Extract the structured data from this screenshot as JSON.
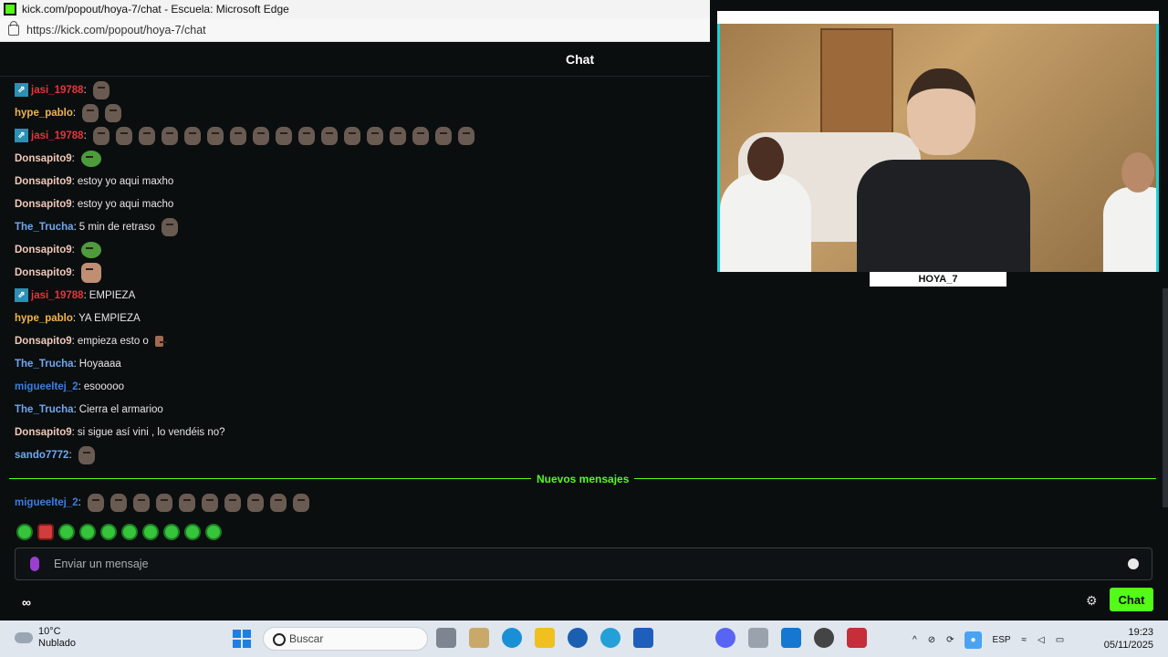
{
  "window": {
    "title": "kick.com/popout/hoya-7/chat - Escuela: Microsoft Edge"
  },
  "address": {
    "url": "https://kick.com/popout/hoya-7/chat"
  },
  "chat_header": {
    "title": "Chat"
  },
  "messages": [
    {
      "user": "jasi_19788",
      "color": "#e8343a",
      "badge": true,
      "text": "",
      "emotes": [
        "face-emote"
      ]
    },
    {
      "user": "hype_pablo",
      "color": "#f0b44a",
      "badge": false,
      "text": "",
      "emotes": [
        "face-emote",
        "face-emote"
      ]
    },
    {
      "user": "jasi_19788",
      "color": "#e8343a",
      "badge": true,
      "text": "",
      "emotes": [
        "face-emote",
        "face-emote",
        "face-emote",
        "face-emote",
        "face-emote",
        "face-emote",
        "face-emote",
        "face-emote",
        "face-emote",
        "face-emote",
        "face-emote",
        "face-emote",
        "face-emote",
        "face-emote",
        "face-emote",
        "face-emote",
        "face-emote"
      ]
    },
    {
      "user": "Donsapito9",
      "color": "#f1c8b8",
      "badge": false,
      "text": "",
      "emotes": [
        "pepe-emote"
      ]
    },
    {
      "user": "Donsapito9",
      "color": "#f1c8b8",
      "badge": false,
      "text": "estoy yo aqui maxho",
      "emotes": []
    },
    {
      "user": "Donsapito9",
      "color": "#f1c8b8",
      "badge": false,
      "text": "estoy yo aqui macho",
      "emotes": []
    },
    {
      "user": "The_Trucha",
      "color": "#6fa8f0",
      "badge": false,
      "text": "5 min de retraso",
      "emotes": [
        "face-emote"
      ]
    },
    {
      "user": "Donsapito9",
      "color": "#f1c8b8",
      "badge": false,
      "text": "",
      "emotes": [
        "pepe-emote"
      ]
    },
    {
      "user": "Donsapito9",
      "color": "#f1c8b8",
      "badge": false,
      "text": "",
      "emotes": [
        "photo-emote"
      ]
    },
    {
      "user": "jasi_19788",
      "color": "#e8343a",
      "badge": true,
      "text": "EMPIEZA",
      "emotes": []
    },
    {
      "user": "hype_pablo",
      "color": "#f0b44a",
      "badge": false,
      "text": "YA EMPIEZA",
      "emotes": []
    },
    {
      "user": "Donsapito9",
      "color": "#f1c8b8",
      "badge": false,
      "text": "empieza esto o",
      "emotes": [
        "finger-emote"
      ]
    },
    {
      "user": "The_Trucha",
      "color": "#6fa8f0",
      "badge": false,
      "text": "Hoyaaaa",
      "emotes": []
    },
    {
      "user": "migueeltej_2",
      "color": "#3a7ee0",
      "badge": false,
      "text": "esooooo",
      "emotes": []
    },
    {
      "user": "The_Trucha",
      "color": "#6fa8f0",
      "badge": false,
      "text": "Cierra el armarioo",
      "emotes": []
    },
    {
      "user": "Donsapito9",
      "color": "#f1c8b8",
      "badge": false,
      "text": "si sigue así vini , lo vendéis no?",
      "emotes": []
    },
    {
      "user": "sando7772",
      "color": "#6fa8f0",
      "badge": false,
      "text": "",
      "emotes": [
        "face-emote"
      ]
    }
  ],
  "new_messages_divider": "Nuevos mensajes",
  "new_messages": [
    {
      "user": "migueeltej_2",
      "color": "#3a7ee0",
      "badge": false,
      "text": "",
      "emotes": [
        "face-emote",
        "face-emote",
        "face-emote",
        "face-emote",
        "face-emote",
        "face-emote",
        "face-emote",
        "face-emote",
        "face-emote",
        "face-emote"
      ]
    }
  ],
  "quick_emotes": [
    "grin-emote",
    "angry-emote",
    "dizzy-emote",
    "smile-emote",
    "jump-emote",
    "laugh-emote",
    "wave-emote",
    "sleep-emote",
    "cheer-emote",
    "cry-emote"
  ],
  "input": {
    "placeholder": "Enviar un mensaje"
  },
  "footer": {
    "chat_button": "Chat",
    "logo_text": "∞"
  },
  "stream": {
    "name": "HOYA_7"
  },
  "taskbar": {
    "weather_temp": "10°C",
    "weather_desc": "Nublado",
    "weather_badge": "1",
    "search_placeholder": "Buscar",
    "lang": "ESP",
    "time": "19:23",
    "date": "05/11/2025"
  },
  "colors": {
    "accent": "#53fc18",
    "background": "#0b0e0f",
    "frame": "#19d2d8"
  }
}
